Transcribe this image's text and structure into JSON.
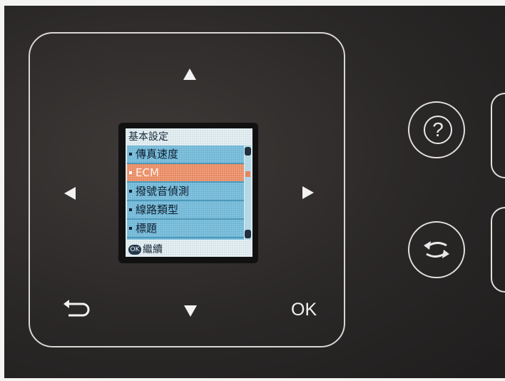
{
  "device": {
    "ok_label": "OK"
  },
  "lcd": {
    "title": "基本設定",
    "items": [
      {
        "label": "傳真速度"
      },
      {
        "label": "ECM"
      },
      {
        "label": "撥號音偵測"
      },
      {
        "label": "線路類型"
      },
      {
        "label": "標題"
      }
    ],
    "selected_index": 1,
    "footer_badge": "OK",
    "footer_label": "繼續"
  },
  "colors": {
    "panel": "#2a2727",
    "lcd_list": "#6eb6d6",
    "lcd_selected": "#e8855c"
  },
  "icons": [
    "arrow-up-icon",
    "arrow-down-icon",
    "arrow-left-icon",
    "arrow-right-icon",
    "back-icon",
    "help-icon",
    "switch-icon"
  ]
}
